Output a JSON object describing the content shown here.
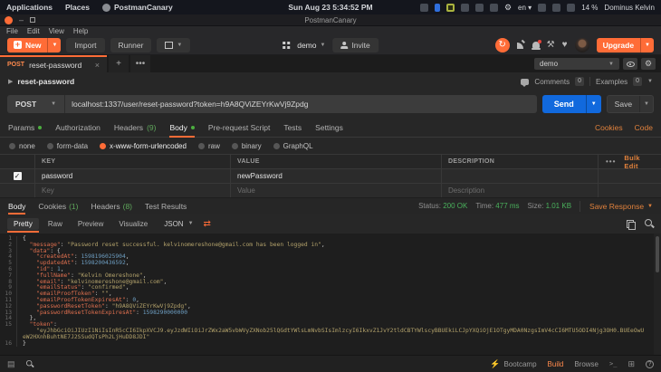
{
  "system_bar": {
    "menu_applications": "Applications",
    "menu_places": "Places",
    "app_name": "PostmanCanary",
    "clock": "Sun Aug 23  5:34:52 PM",
    "keyboard_layout": "en",
    "battery": "14 %",
    "user": "Dominus Kelvin"
  },
  "window": {
    "title": "PostmanCanary"
  },
  "menu_bar": {
    "items": [
      "File",
      "Edit",
      "View",
      "Help"
    ]
  },
  "toolbar": {
    "new_label": "New",
    "import_label": "Import",
    "runner_label": "Runner",
    "workspace_label": "demo",
    "invite_label": "Invite",
    "upgrade_label": "Upgrade"
  },
  "tab_strip": {
    "tab_method": "POST",
    "tab_name": "reset-password",
    "environment": "demo"
  },
  "request": {
    "title": "reset-password",
    "comments_label": "Comments",
    "comments_count": "0",
    "examples_label": "Examples",
    "examples_count": "0",
    "method": "POST",
    "url": "localhost:1337/user/reset-password?token=h9A8QViZEYrKwVj9Zpdg",
    "send_label": "Send",
    "save_label": "Save",
    "tabs": [
      {
        "label": "Params"
      },
      {
        "label": "Authorization"
      },
      {
        "label": "Headers",
        "count": "(9)"
      },
      {
        "label": "Body"
      },
      {
        "label": "Pre-request Script"
      },
      {
        "label": "Tests"
      },
      {
        "label": "Settings"
      }
    ],
    "cookies_link": "Cookies",
    "code_link": "Code",
    "body_types": [
      "none",
      "form-data",
      "x-www-form-urlencoded",
      "raw",
      "binary",
      "GraphQL"
    ],
    "selected_body_type": "x-www-form-urlencoded",
    "kv": {
      "col_key": "KEY",
      "col_value": "VALUE",
      "col_description": "DESCRIPTION",
      "more": "•••",
      "bulk_edit": "Bulk Edit",
      "row": {
        "key": "password",
        "value": "newPassword",
        "description": ""
      },
      "placeholder": {
        "key": "Key",
        "value": "Value",
        "description": "Description"
      }
    }
  },
  "response": {
    "tab_body": "Body",
    "tab_cookies": "Cookies",
    "cookies_count": "(1)",
    "tab_headers": "Headers",
    "headers_count": "(8)",
    "tab_tests": "Test Results",
    "status_label": "Status:",
    "status_value": "200 OK",
    "time_label": "Time:",
    "time_value": "477 ms",
    "size_label": "Size:",
    "size_value": "1.01 KB",
    "save_response_label": "Save Response",
    "view_pretty": "Pretty",
    "view_raw": "Raw",
    "view_preview": "Preview",
    "view_visualize": "Visualize",
    "language": "JSON",
    "code": {
      "lines": [
        {
          "n": "1",
          "t": [
            [
              "p",
              "{"
            ]
          ]
        },
        {
          "n": "2",
          "t": [
            [
              "p",
              "  "
            ],
            [
              "k",
              "\"message\""
            ],
            [
              "p",
              ": "
            ],
            [
              "s",
              "\"Password reset successful. kelvinomereshone@gmail.com has been logged in\""
            ],
            [
              "p",
              ","
            ]
          ]
        },
        {
          "n": "3",
          "t": [
            [
              "p",
              "  "
            ],
            [
              "k",
              "\"data\""
            ],
            [
              "p",
              ": {"
            ]
          ]
        },
        {
          "n": "4",
          "t": [
            [
              "p",
              "    "
            ],
            [
              "k",
              "\"createdAt\""
            ],
            [
              "p",
              ": "
            ],
            [
              "m",
              "1598196025904"
            ],
            [
              "p",
              ","
            ]
          ]
        },
        {
          "n": "5",
          "t": [
            [
              "p",
              "    "
            ],
            [
              "k",
              "\"updatedAt\""
            ],
            [
              "p",
              ": "
            ],
            [
              "m",
              "1598200436592"
            ],
            [
              "p",
              ","
            ]
          ]
        },
        {
          "n": "6",
          "t": [
            [
              "p",
              "    "
            ],
            [
              "k",
              "\"id\""
            ],
            [
              "p",
              ": "
            ],
            [
              "m",
              "1"
            ],
            [
              "p",
              ","
            ]
          ]
        },
        {
          "n": "7",
          "t": [
            [
              "p",
              "    "
            ],
            [
              "k",
              "\"fullName\""
            ],
            [
              "p",
              ": "
            ],
            [
              "s",
              "\"Kelvin Omereshone\""
            ],
            [
              "p",
              ","
            ]
          ]
        },
        {
          "n": "8",
          "t": [
            [
              "p",
              "    "
            ],
            [
              "k",
              "\"email\""
            ],
            [
              "p",
              ": "
            ],
            [
              "s",
              "\"kelvinomereshone@gmail.com\""
            ],
            [
              "p",
              ","
            ]
          ]
        },
        {
          "n": "9",
          "t": [
            [
              "p",
              "    "
            ],
            [
              "k",
              "\"emailStatus\""
            ],
            [
              "p",
              ": "
            ],
            [
              "s",
              "\"confirmed\""
            ],
            [
              "p",
              ","
            ]
          ]
        },
        {
          "n": "10",
          "t": [
            [
              "p",
              "    "
            ],
            [
              "k",
              "\"emailProofToken\""
            ],
            [
              "p",
              ": "
            ],
            [
              "s",
              "\"\""
            ],
            [
              "p",
              ","
            ]
          ]
        },
        {
          "n": "11",
          "t": [
            [
              "p",
              "    "
            ],
            [
              "k",
              "\"emailProofTokenExpiresAt\""
            ],
            [
              "p",
              ": "
            ],
            [
              "m",
              "0"
            ],
            [
              "p",
              ","
            ]
          ]
        },
        {
          "n": "12",
          "t": [
            [
              "p",
              "    "
            ],
            [
              "k",
              "\"passwordResetToken\""
            ],
            [
              "p",
              ": "
            ],
            [
              "s",
              "\"h9A8QViZEYrKwVj9Zpdg\""
            ],
            [
              "p",
              ","
            ]
          ]
        },
        {
          "n": "13",
          "t": [
            [
              "p",
              "    "
            ],
            [
              "k",
              "\"passwordResetTokenExpiresAt\""
            ],
            [
              "p",
              ": "
            ],
            [
              "m",
              "1598290000000"
            ]
          ]
        },
        {
          "n": "14",
          "t": [
            [
              "p",
              "  },"
            ]
          ]
        },
        {
          "n": "15",
          "t": [
            [
              "p",
              "  "
            ],
            [
              "k",
              "\"token\""
            ],
            [
              "p",
              ":\n    "
            ],
            [
              "s",
              "\"eyJhbGciOiJIUzI1NiIsInR5cCI6IkpXVCJ9.eyJzdWIiOiJrZWx2aW5vbWVyZXNob25lQGdtYWlsLmNvbSIsImlzcyI6IkxvZ1JvY2tldCBTYWlscyBBUEkiLCJpYXQiOjE1OTgyMDA0NzgsImV4cCI6MTU5ODI4Njg3OH0.BUEeOwUeW2HXnhBuhtNE7J2SSudQTsPh2LjHuDD8JDI\""
            ]
          ]
        },
        {
          "n": "16",
          "t": [
            [
              "p",
              "}"
            ]
          ]
        }
      ]
    }
  },
  "status_bar": {
    "bootcamp": "Bootcamp",
    "build": "Build",
    "browse": "Browse"
  },
  "colors": {
    "accent": "#ff6c37",
    "send_blue": "#1169dd",
    "ok_green": "#4ab15c"
  }
}
